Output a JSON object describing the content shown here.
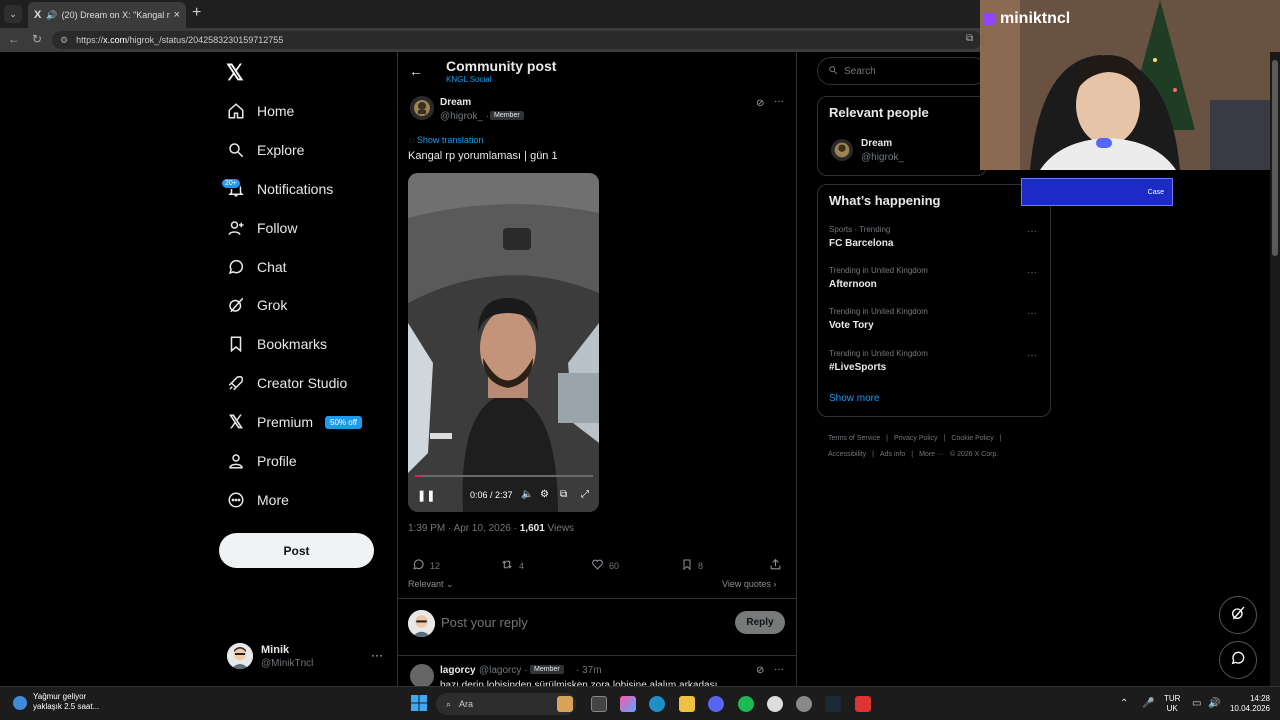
{
  "browser": {
    "tab_title": "(20) Dream on X: \"Kangal rp y",
    "tab_favicon": "X",
    "url_host": "x.com",
    "url_prefix": "https://",
    "url_path": "/higrok_/status/2042583230159712755"
  },
  "nav": {
    "items": [
      {
        "label": "Home",
        "icon": "home-icon"
      },
      {
        "label": "Explore",
        "icon": "search-icon"
      },
      {
        "label": "Notifications",
        "icon": "bell-icon"
      },
      {
        "label": "Follow",
        "icon": "person-add-icon"
      },
      {
        "label": "Chat",
        "icon": "chat-icon"
      },
      {
        "label": "Grok",
        "icon": "grok-icon"
      },
      {
        "label": "Bookmarks",
        "icon": "bookmark-icon"
      },
      {
        "label": "Creator Studio",
        "icon": "rocket-icon"
      },
      {
        "label": "Premium",
        "icon": "x-icon"
      },
      {
        "label": "Profile",
        "icon": "person-icon"
      },
      {
        "label": "More",
        "icon": "more-circle-icon"
      }
    ],
    "notif_badge": "20+",
    "premium_badge": "50% off",
    "post_button": "Post"
  },
  "me": {
    "name": "Minik",
    "handle": "@MinikTncl"
  },
  "header": {
    "title": "Community post",
    "subtitle": "KNGL Social"
  },
  "post": {
    "author": "Dream",
    "handle": "@higrok_ ·",
    "badge": "Member",
    "show_translation": "Show translation",
    "text": "Kangal rp yorumlaması | gün 1",
    "video_time": "0:06 / 2:37",
    "video_progress": 0.04,
    "meta_time": "1:39 PM · Apr 10, 2026 · ",
    "views_count": "1,601",
    "views_label": " Views",
    "replies": "12",
    "reposts": "4",
    "likes": "60",
    "bookmarks": "8",
    "sort_label": "Relevant ⌄",
    "view_quotes": "View quotes ›",
    "reply_placeholder": "Post your reply",
    "reply_button": "Reply"
  },
  "next_reply": {
    "name": "lagorcy",
    "handle": "@lagorcy ·",
    "badge": "Member",
    "time": "· 37m",
    "text": "bazı derin lobisinden sürülmişken zora lobisine alalım arkadaşı"
  },
  "right": {
    "search_placeholder": "Search",
    "relevant_title": "Relevant people",
    "relevant_name": "Dream",
    "relevant_handle": "@higrok_",
    "happening_title": "What’s happening",
    "trends": [
      {
        "context": "Sports · Trending",
        "name": "FC Barcelona"
      },
      {
        "context": "Trending in United Kingdom",
        "name": "Afternoon"
      },
      {
        "context": "Trending in United Kingdom",
        "name": "Vote Tory"
      },
      {
        "context": "Trending in United Kingdom",
        "name": "#LiveSports"
      }
    ],
    "show_more": "Show more",
    "footer": [
      "Terms of Service",
      "|",
      "Privacy Policy",
      "|",
      "Cookie Policy",
      "|",
      "Accessibility",
      "|",
      "Ads info",
      "|",
      "More ···",
      "© 2026 X Corp."
    ]
  },
  "overlay": {
    "streamer": "miniktncl",
    "ad_text": "Case"
  },
  "taskbar": {
    "weather_title": "Yağmur geliyor",
    "weather_sub": "yaklaşık 2.5 saat...",
    "search": "Ara",
    "lang_top": "TUR",
    "lang_bottom": "UK",
    "time": "14:28",
    "date": "10.04.2026"
  },
  "colors": {
    "accent": "#1d9bf0",
    "bg": "#000000",
    "border": "#2f3336",
    "muted": "#71767b"
  }
}
